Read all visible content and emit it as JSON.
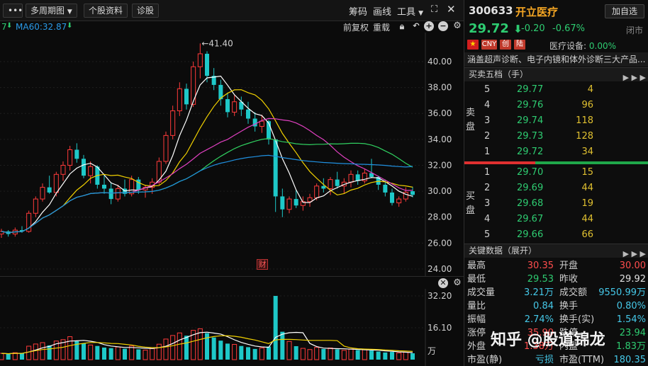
{
  "toolbar": {
    "menu": "•••",
    "period": "多周期图",
    "stock_info": "个股资料",
    "diagnose": "诊股",
    "chips": "筹码",
    "draw": "画线",
    "tools": "工具",
    "expand": "⛶"
  },
  "legend": {
    "prefix": "7",
    "ma60": "MA60:32.87",
    "forward_adjust": "前复权",
    "reset": "重载"
  },
  "stock": {
    "code": "300633",
    "name": "开立医疗",
    "add_label": "加自选",
    "price": "29.72",
    "change": "-0.20",
    "change_pct": "-0.67%",
    "status": "闭市",
    "industry_label": "医疗设备:",
    "industry_value": "0.00%",
    "tags": [
      "CNY",
      "创",
      "陆"
    ],
    "description": "涵盖超声诊断、电子内镜和体外诊断三大产品..."
  },
  "orderbook": {
    "title": "买卖五档（手）",
    "sell_label": [
      "卖",
      "盘"
    ],
    "buy_label": [
      "买",
      "盘"
    ],
    "asks": [
      {
        "level": "5",
        "price": "29.77",
        "qty": "4"
      },
      {
        "level": "4",
        "price": "29.76",
        "qty": "96"
      },
      {
        "level": "3",
        "price": "29.74",
        "qty": "118"
      },
      {
        "level": "2",
        "price": "29.73",
        "qty": "128"
      },
      {
        "level": "1",
        "price": "29.72",
        "qty": "34"
      }
    ],
    "bids": [
      {
        "level": "1",
        "price": "29.70",
        "qty": "15"
      },
      {
        "level": "2",
        "price": "29.69",
        "qty": "44"
      },
      {
        "level": "3",
        "price": "29.68",
        "qty": "19"
      },
      {
        "level": "4",
        "price": "29.67",
        "qty": "44"
      },
      {
        "level": "5",
        "price": "29.66",
        "qty": "66"
      }
    ]
  },
  "key_data": {
    "title": "关键数据（展开）",
    "rows": [
      {
        "l1": "最高",
        "v1": "30.35",
        "c1": "red",
        "l2": "开盘",
        "v2": "30.00",
        "c2": "red"
      },
      {
        "l1": "最低",
        "v1": "29.53",
        "c1": "green",
        "l2": "昨收",
        "v2": "29.92",
        "c2": "white"
      },
      {
        "l1": "成交量",
        "v1": "3.21万",
        "c1": "cyan",
        "l2": "成交额",
        "v2": "9550.99万",
        "c2": "cyan"
      },
      {
        "l1": "量比",
        "v1": "0.84",
        "c1": "cyan",
        "l2": "换手",
        "v2": "0.80%",
        "c2": "cyan"
      },
      {
        "l1": "振幅",
        "v1": "2.74%",
        "c1": "cyan",
        "l2": "换手(实)",
        "v2": "1.54%",
        "c2": "cyan"
      },
      {
        "l1": "涨停",
        "v1": "35.90",
        "c1": "red",
        "l2": "跌停",
        "v2": "23.94",
        "c2": "green"
      },
      {
        "l1": "外盘",
        "v1": "1.38万",
        "c1": "red",
        "l2": "内盘",
        "v2": "1.83万",
        "c2": "green"
      },
      {
        "l1": "市盈(静)",
        "v1": "亏损",
        "c1": "cyan",
        "l2": "市盈(TTM)",
        "v2": "180.35",
        "c2": "cyan"
      }
    ]
  },
  "watermark": "知乎 @股道锦龙",
  "colors": {
    "up": "#ff3b3b",
    "down": "#1ec8c8",
    "ma5": "#ffffff",
    "ma10": "#f0d000",
    "ma20": "#e040c0",
    "ma30": "#30d060",
    "ma60": "#2090e0"
  },
  "chart_data": [
    {
      "type": "candlestick",
      "y_ticks": [
        "40.00",
        "38.00",
        "36.00",
        "34.00",
        "32.00",
        "30.00",
        "28.00",
        "26.00",
        "24.00"
      ],
      "ylim": [
        24,
        41.8
      ],
      "annotation": "←41.40",
      "event_marker": "财",
      "candles": [
        [
          26.7,
          27.1,
          26.4,
          26.9
        ],
        [
          26.9,
          27.0,
          26.5,
          26.7
        ],
        [
          26.7,
          27.2,
          26.5,
          27.0
        ],
        [
          27.0,
          27.3,
          26.8,
          26.9
        ],
        [
          26.9,
          28.5,
          26.8,
          28.3
        ],
        [
          28.3,
          29.6,
          28.0,
          29.4
        ],
        [
          29.4,
          30.6,
          29.2,
          30.3
        ],
        [
          30.3,
          31.2,
          29.8,
          29.9
        ],
        [
          29.9,
          31.5,
          29.6,
          31.3
        ],
        [
          31.3,
          32.3,
          30.8,
          32.0
        ],
        [
          32.0,
          33.5,
          31.6,
          33.2
        ],
        [
          33.2,
          33.7,
          32.2,
          32.5
        ],
        [
          32.5,
          32.8,
          31.0,
          31.2
        ],
        [
          31.2,
          32.3,
          30.6,
          31.9
        ],
        [
          31.9,
          32.0,
          30.2,
          30.5
        ],
        [
          30.5,
          31.3,
          29.8,
          30.2
        ],
        [
          30.2,
          30.7,
          29.0,
          29.4
        ],
        [
          29.4,
          30.5,
          29.2,
          30.2
        ],
        [
          30.2,
          30.9,
          29.6,
          29.8
        ],
        [
          29.8,
          31.2,
          29.6,
          30.9
        ],
        [
          30.9,
          31.1,
          29.8,
          30.1
        ],
        [
          30.1,
          30.5,
          29.5,
          30.3
        ],
        [
          30.3,
          31.0,
          29.8,
          30.7
        ],
        [
          30.7,
          32.6,
          30.5,
          32.3
        ],
        [
          32.3,
          34.6,
          32.1,
          34.3
        ],
        [
          34.3,
          36.6,
          34.0,
          36.2
        ],
        [
          36.2,
          38.4,
          35.8,
          37.9
        ],
        [
          37.9,
          38.3,
          36.3,
          36.7
        ],
        [
          36.7,
          40.0,
          36.5,
          39.6
        ],
        [
          39.6,
          41.4,
          38.7,
          40.6
        ],
        [
          40.6,
          40.8,
          38.4,
          38.9
        ],
        [
          38.9,
          39.5,
          37.8,
          38.2
        ],
        [
          38.2,
          38.6,
          36.6,
          37.1
        ],
        [
          37.1,
          37.6,
          35.7,
          36.1
        ],
        [
          36.1,
          37.4,
          35.8,
          36.9
        ],
        [
          36.9,
          37.3,
          35.8,
          36.3
        ],
        [
          36.3,
          36.9,
          35.2,
          35.6
        ],
        [
          35.6,
          36.1,
          34.6,
          35.0
        ],
        [
          35.0,
          35.9,
          34.5,
          35.4
        ],
        [
          35.4,
          35.5,
          33.6,
          34.0
        ],
        [
          34.0,
          32.1,
          28.4,
          29.6
        ],
        [
          29.6,
          30.2,
          28.0,
          28.6
        ],
        [
          28.6,
          29.6,
          28.3,
          29.4
        ],
        [
          29.4,
          30.1,
          28.7,
          28.9
        ],
        [
          28.9,
          29.6,
          28.5,
          29.2
        ],
        [
          29.2,
          29.8,
          28.8,
          29.5
        ],
        [
          29.5,
          30.6,
          29.3,
          30.4
        ],
        [
          30.4,
          31.0,
          29.9,
          30.2
        ],
        [
          30.2,
          31.1,
          29.7,
          30.9
        ],
        [
          30.9,
          31.5,
          30.2,
          30.4
        ],
        [
          30.4,
          31.0,
          29.8,
          30.7
        ],
        [
          30.7,
          31.6,
          30.3,
          31.3
        ],
        [
          31.3,
          31.6,
          30.5,
          30.8
        ],
        [
          30.8,
          31.7,
          30.6,
          31.4
        ],
        [
          31.4,
          32.5,
          31.0,
          31.1
        ],
        [
          31.1,
          31.2,
          30.1,
          30.5
        ],
        [
          30.5,
          30.9,
          29.6,
          29.9
        ],
        [
          29.9,
          30.2,
          28.9,
          29.1
        ],
        [
          29.1,
          29.6,
          28.8,
          29.4
        ],
        [
          29.4,
          30.3,
          29.2,
          29.92
        ],
        [
          30.0,
          30.35,
          29.53,
          29.72
        ]
      ]
    },
    {
      "type": "bar",
      "y_ticks": [
        "32.20",
        "16.10",
        "万"
      ],
      "ylim": [
        0,
        32.2
      ],
      "values": [
        3.2,
        2.8,
        3.5,
        3.1,
        6.8,
        7.9,
        8.6,
        7.2,
        9.4,
        10.1,
        11.6,
        9.3,
        8.2,
        7.4,
        6.9,
        6.1,
        5.8,
        6.4,
        5.5,
        6.9,
        5.2,
        4.8,
        5.6,
        7.8,
        10.4,
        12.2,
        13.5,
        12.1,
        14.8,
        15.6,
        13.4,
        11.2,
        9.6,
        8.1,
        7.7,
        6.9,
        6.3,
        5.4,
        5.9,
        6.6,
        32.2,
        14.1,
        9.2,
        6.8,
        5.7,
        5.1,
        6.2,
        5.4,
        5.9,
        5.2,
        4.7,
        5.3,
        4.8,
        5.0,
        4.6,
        4.1,
        3.6,
        3.9,
        3.4,
        3.8,
        3.21
      ]
    }
  ]
}
